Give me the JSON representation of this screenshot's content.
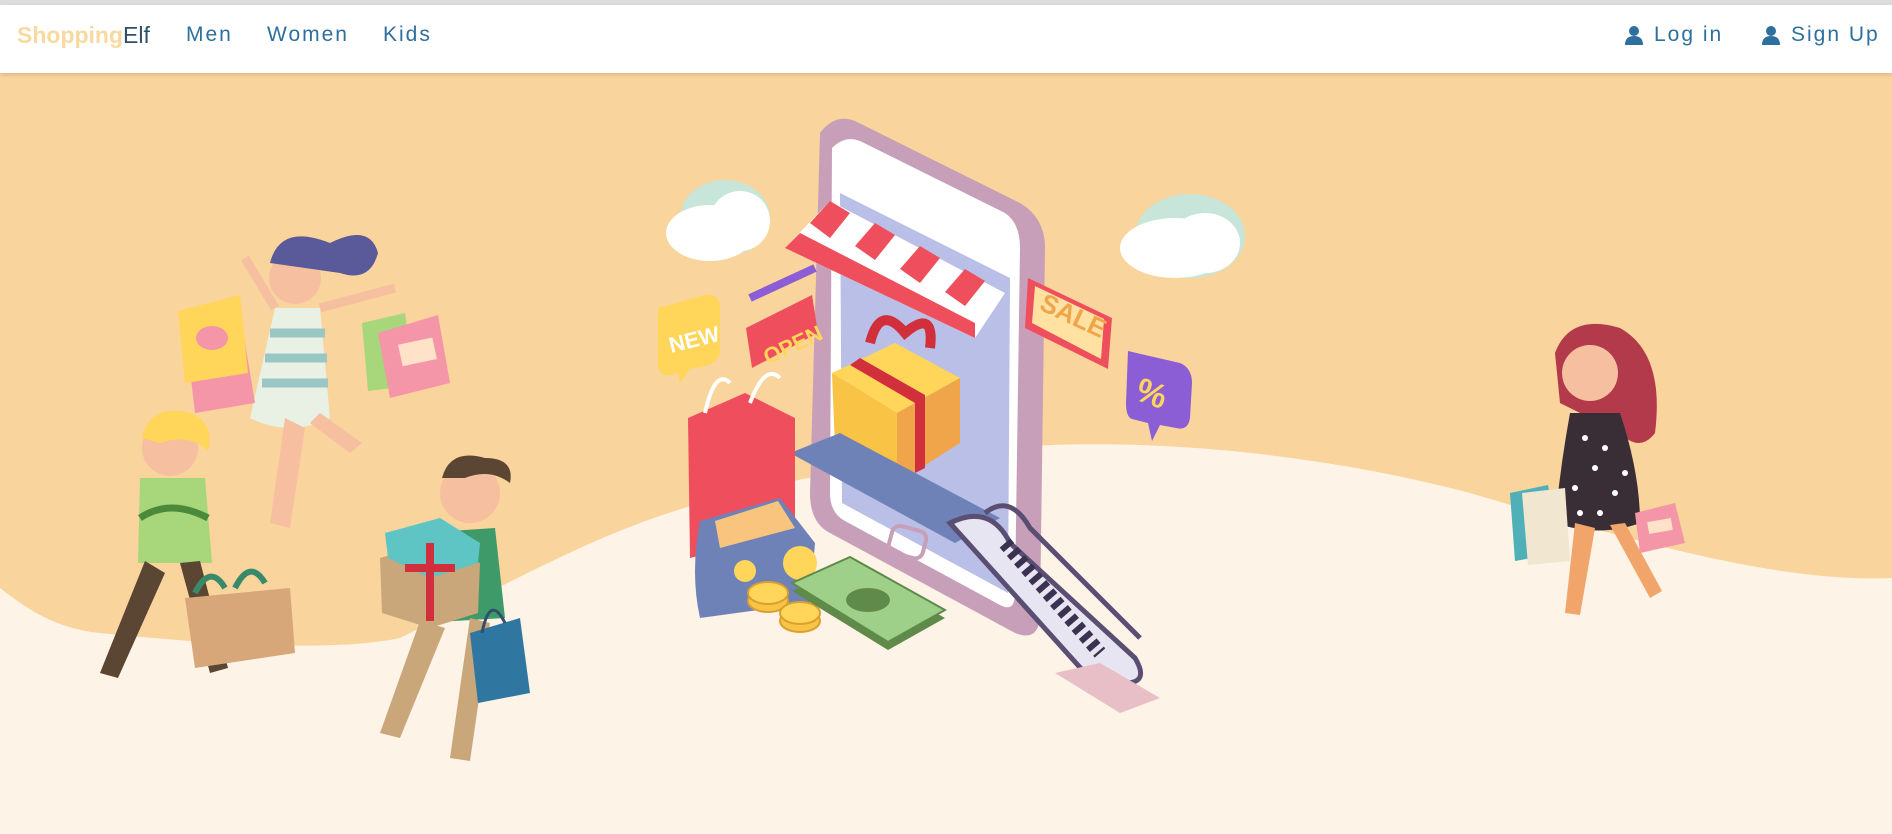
{
  "brand": {
    "part1": "Shopping",
    "part2": "Elf"
  },
  "nav": {
    "items": [
      {
        "label": "Men"
      },
      {
        "label": "Women"
      },
      {
        "label": "Kids"
      }
    ],
    "login_label": "Log in",
    "signup_label": "Sign Up"
  },
  "hero": {
    "signs": {
      "new": "NEW",
      "open": "OPEN",
      "sale": "SALE",
      "percent": "%"
    }
  },
  "colors": {
    "accent": "#2f6f9e",
    "brand_light": "#f8d9a0",
    "brand_dark": "#2f4f6b",
    "hero_band": "#f9d49c",
    "hero_base": "#fdf3e6"
  }
}
